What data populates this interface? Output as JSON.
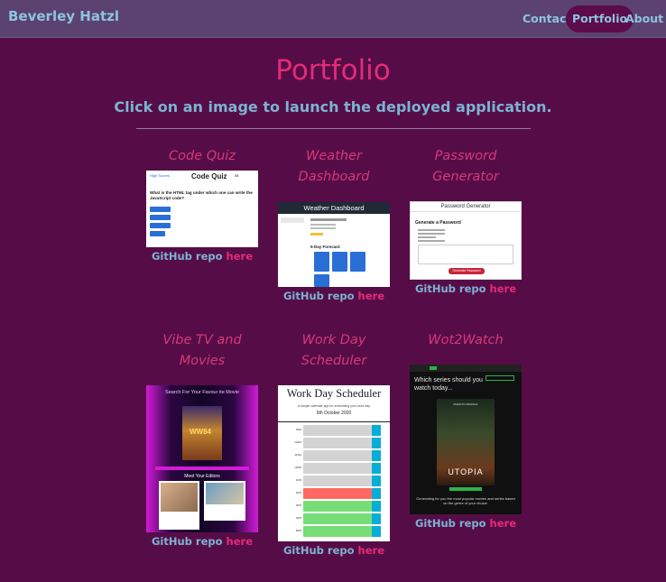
{
  "nav": {
    "brand": "Beverley Hatzl",
    "links": [
      "Contact",
      "Portfolio",
      "About"
    ]
  },
  "page": {
    "title": "Portfolio",
    "subtitle": "Click on an image to launch the deployed application."
  },
  "repo_text": "GitHub repo",
  "repo_link": "here",
  "projects": [
    {
      "title_lines": [
        "Code Quiz"
      ]
    },
    {
      "title_lines": [
        "Weather",
        "Dashboard"
      ]
    },
    {
      "title_lines": [
        "Password",
        "Generator"
      ]
    },
    {
      "title_lines": [
        "Vibe TV and",
        "Movies"
      ]
    },
    {
      "title_lines": [
        "Work Day",
        "Scheduler"
      ]
    },
    {
      "title_lines": [
        "Wot2Watch"
      ]
    }
  ],
  "thumbs": {
    "quiz": {
      "highscores": "High Scores",
      "heading": "Code Quiz",
      "timer": "58",
      "question": "What is the HTML tag under which one can write the JavaScript code?"
    },
    "weather": {
      "heading": "Weather Dashboard",
      "forecast": "5-Day Forecast:"
    },
    "password": {
      "heading": "Password Generator",
      "subheading": "Generate a Password",
      "button": "Generate Password"
    },
    "vibe": {
      "heading": "Search For Your Favour ite Movie",
      "editors": "Meet Your Editors",
      "poster": "WW84"
    },
    "workday": {
      "heading": "Work Day Scheduler",
      "tagline": "A simple calendar app for scheduling your work day",
      "date": "9th October 2020",
      "hours": [
        "9AM",
        "10AM",
        "11AM",
        "12PM",
        "1PM",
        "2PM",
        "3PM",
        "4PM",
        "5PM"
      ]
    },
    "wot": {
      "question": "Which series should you watch today...",
      "poster_title": "UTOPIA",
      "poster_top": "AMAZON ORIGINAL",
      "caption": "Generating for you the most popular movies and series based on the genre of your choice."
    }
  },
  "colors": {
    "background": "#560d47",
    "navbar": "#5b4271",
    "accent": "#e42b77",
    "text": "#7cb3d3"
  }
}
